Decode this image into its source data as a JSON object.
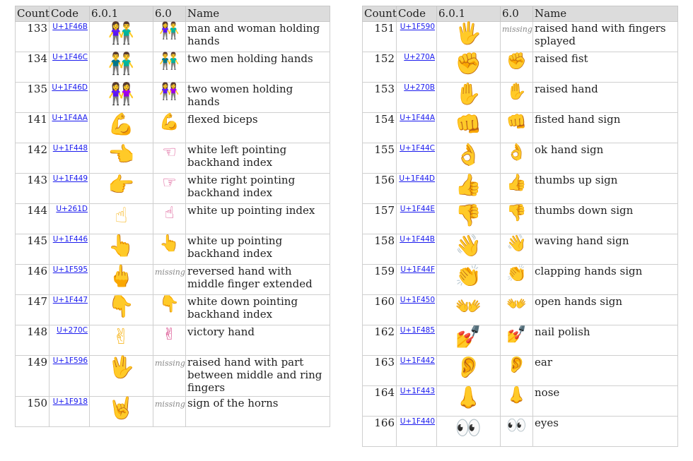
{
  "headers": [
    "Count",
    "Code",
    "6.0.1",
    "6.0",
    "Name"
  ],
  "missing_label": "missing",
  "colors": {
    "link": "#1a1aee",
    "header_bg": "#dcdcdc",
    "emoji_new": "#f7b928",
    "emoji_old": "#d9488a"
  },
  "left": [
    {
      "count": "133",
      "code": "U+1F46B",
      "e601": "👫",
      "e60": "👫",
      "name": "man and woman holding hands"
    },
    {
      "count": "134",
      "code": "U+1F46C",
      "e601": "👬",
      "e60": "👬",
      "name": "two men holding hands"
    },
    {
      "count": "135",
      "code": "U+1F46D",
      "e601": "👭",
      "e60": "👭",
      "name": "two women holding hands"
    },
    {
      "count": "141",
      "code": "U+1F4AA",
      "e601": "💪",
      "e60": "💪",
      "name": "flexed biceps"
    },
    {
      "count": "142",
      "code": "U+1F448",
      "e601": "👈",
      "e60": "☜",
      "name": "white left pointing backhand index"
    },
    {
      "count": "143",
      "code": "U+1F449",
      "e601": "👉",
      "e60": "☞",
      "name": "white right pointing backhand index"
    },
    {
      "count": "144",
      "code": "U+261D",
      "e601": "☝",
      "e60": "☝",
      "name": "white up pointing index"
    },
    {
      "count": "145",
      "code": "U+1F446",
      "e601": "👆",
      "e60": "👆",
      "name": "white up pointing backhand index"
    },
    {
      "count": "146",
      "code": "U+1F595",
      "e601": "🖕",
      "e60": "",
      "name": "reversed hand with middle finger extended"
    },
    {
      "count": "147",
      "code": "U+1F447",
      "e601": "👇",
      "e60": "👇",
      "name": "white down pointing backhand index"
    },
    {
      "count": "148",
      "code": "U+270C",
      "e601": "✌",
      "e60": "✌",
      "name": "victory hand"
    },
    {
      "count": "149",
      "code": "U+1F596",
      "e601": "🖖",
      "e60": "",
      "name": "raised hand with part between middle and ring fingers"
    },
    {
      "count": "150",
      "code": "U+1F918",
      "e601": "🤘",
      "e60": "",
      "name": "sign of the horns"
    }
  ],
  "right": [
    {
      "count": "151",
      "code": "U+1F590",
      "e601": "🖐",
      "e60": "",
      "name": "raised hand with fingers splayed"
    },
    {
      "count": "152",
      "code": "U+270A",
      "e601": "✊",
      "e60": "✊",
      "name": "raised fist"
    },
    {
      "count": "153",
      "code": "U+270B",
      "e601": "✋",
      "e60": "✋",
      "name": "raised hand"
    },
    {
      "count": "154",
      "code": "U+1F44A",
      "e601": "👊",
      "e60": "👊",
      "name": "fisted hand sign"
    },
    {
      "count": "155",
      "code": "U+1F44C",
      "e601": "👌",
      "e60": "👌",
      "name": "ok hand sign"
    },
    {
      "count": "156",
      "code": "U+1F44D",
      "e601": "👍",
      "e60": "👍",
      "name": "thumbs up sign"
    },
    {
      "count": "157",
      "code": "U+1F44E",
      "e601": "👎",
      "e60": "👎",
      "name": "thumbs down sign"
    },
    {
      "count": "158",
      "code": "U+1F44B",
      "e601": "👋",
      "e60": "👋",
      "name": "waving hand sign"
    },
    {
      "count": "159",
      "code": "U+1F44F",
      "e601": "👏",
      "e60": "👏",
      "name": "clapping hands sign"
    },
    {
      "count": "160",
      "code": "U+1F450",
      "e601": "👐",
      "e60": "👐",
      "name": "open hands sign"
    },
    {
      "count": "162",
      "code": "U+1F485",
      "e601": "💅",
      "e60": "💅",
      "name": "nail polish"
    },
    {
      "count": "163",
      "code": "U+1F442",
      "e601": "👂",
      "e60": "👂",
      "name": "ear"
    },
    {
      "count": "164",
      "code": "U+1F443",
      "e601": "👃",
      "e60": "👃",
      "name": "nose"
    },
    {
      "count": "166",
      "code": "U+1F440",
      "e601": "👀",
      "e60": "👀",
      "name": "eyes"
    }
  ]
}
